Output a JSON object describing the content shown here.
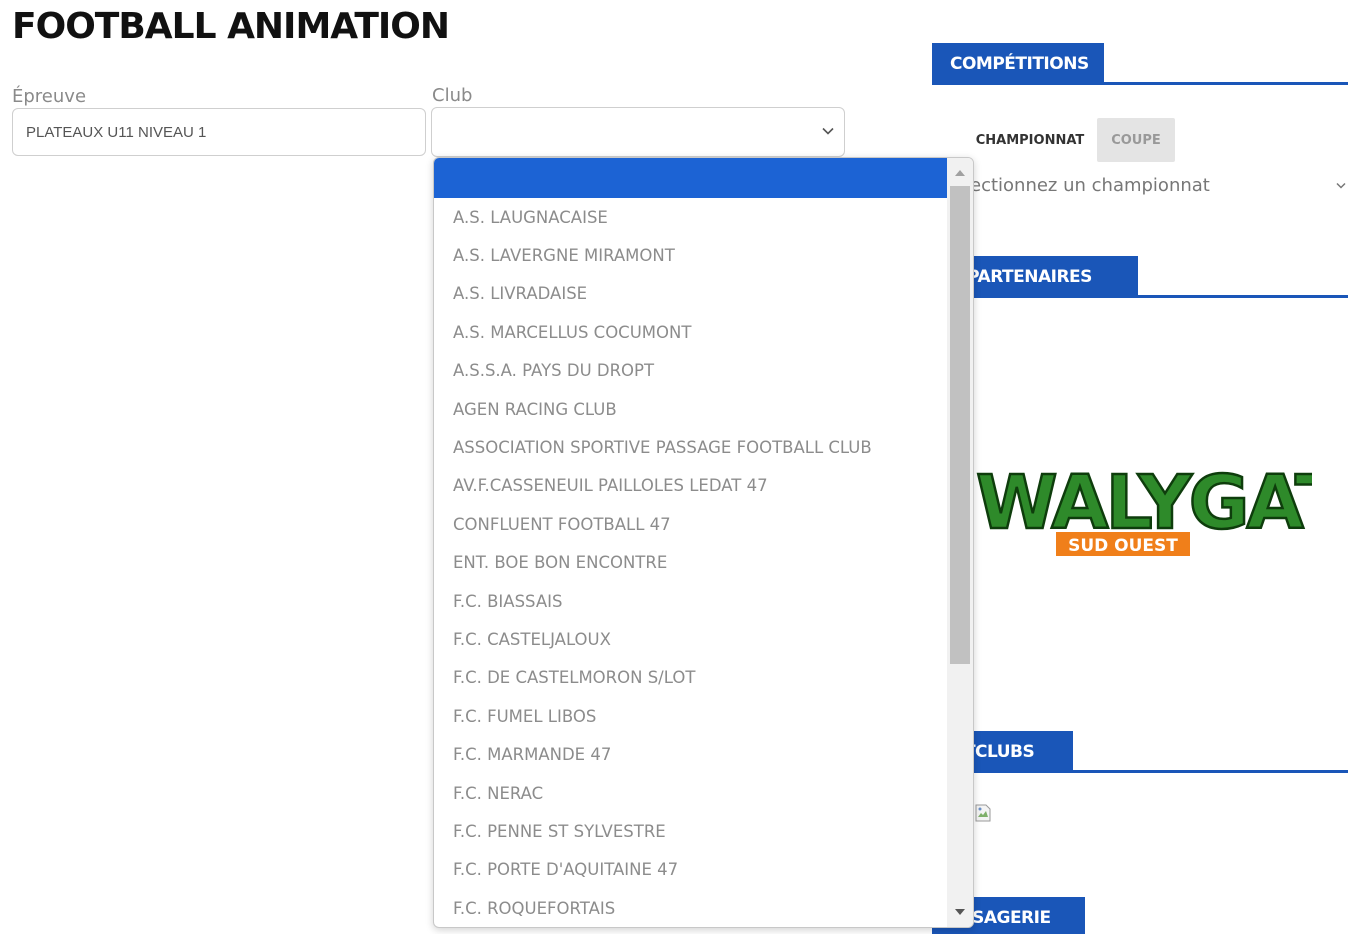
{
  "page": {
    "title": "FOOTBALL ANIMATION"
  },
  "form": {
    "epreuve_label": "Épreuve",
    "epreuve_value": "PLATEAUX U11 NIVEAU 1",
    "club_label": "Club",
    "club_value": ""
  },
  "dropdown": {
    "selected_option": "",
    "options": [
      "A.S. LAUGNACAISE",
      "A.S. LAVERGNE MIRAMONT",
      "A.S. LIVRADAISE",
      "A.S. MARCELLUS COCUMONT",
      "A.S.S.A. PAYS DU DROPT",
      "AGEN RACING CLUB",
      "ASSOCIATION SPORTIVE PASSAGE FOOTBALL CLUB",
      "AV.F.CASSENEUIL PAILLOLES LEDAT 47",
      "CONFLUENT FOOTBALL 47",
      "ENT. BOE BON ENCONTRE",
      "F.C. BIASSAIS",
      "F.C. CASTELJALOUX",
      "F.C. DE CASTELMORON S/LOT",
      "F.C. FUMEL LIBOS",
      "F.C. MARMANDE 47",
      "F.C. NERAC",
      "F.C. PENNE ST SYLVESTRE",
      "F.C. PORTE D'AQUITAINE 47",
      "F.C. ROQUEFORTAIS"
    ],
    "scroll_position": 0.0
  },
  "sidebar": {
    "competitions_title": "COMPÉTITIONS",
    "tab_championnat": "CHAMPIONNAT",
    "tab_coupe": "COUPE",
    "championnat_select": "ectionnez un championnat",
    "partenaires_title": "S PARTENAIRES",
    "partner_logo": {
      "name": "WALYGATOR",
      "sub": "SUD OUEST"
    },
    "footclubs_title": "OTCLUBS",
    "messagerie_title": "ESSAGERIE"
  },
  "colors": {
    "brand_blue": "#1a56b8",
    "selected_option": "#1c63d4",
    "walygator_green": "#2e8a2a",
    "walygator_orange": "#f07f1a"
  }
}
